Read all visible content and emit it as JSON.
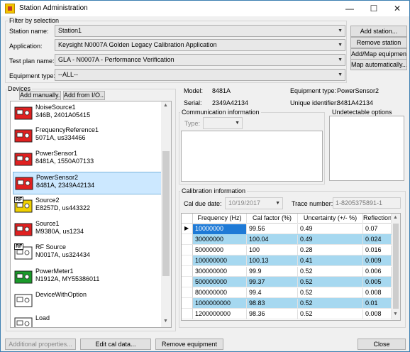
{
  "window": {
    "title": "Station Administration",
    "minimize": "—",
    "maximize": "☐",
    "close": "✕"
  },
  "filter": {
    "group_title": "Filter by selection",
    "station_label": "Station name:",
    "station_value": "Station1",
    "application_label": "Application:",
    "application_value": "Keysight N0007A Golden Legacy Calibration Application",
    "testplan_label": "Test plan name:",
    "testplan_value": "GLA - N0007A - Performance Verification",
    "equiptype_label": "Equipment type:",
    "equiptype_value": "--ALL--"
  },
  "side_buttons": {
    "add_station": "Add station...",
    "remove_station": "Remove station",
    "add_map": "Add/Map equipment...",
    "map_auto": "Map automatically..."
  },
  "devices": {
    "group_title": "Devices",
    "add_manually": "Add manually...",
    "add_from_io": "Add from I/O...",
    "items": [
      {
        "name": "NoiseSource1",
        "detail": "346B, 2401A05415",
        "icon": "noise-source-icon",
        "color": "#e02020"
      },
      {
        "name": "FrequencyReference1",
        "detail": "5071A, us334466",
        "icon": "frequency-reference-icon",
        "color": "#e02020"
      },
      {
        "name": "PowerSensor1",
        "detail": "8481A, 1550A07133",
        "icon": "power-sensor-icon",
        "color": "#e02020"
      },
      {
        "name": "PowerSensor2",
        "detail": "8481A, 2349A42134",
        "icon": "power-sensor-icon",
        "color": "#e02020"
      },
      {
        "name": "Source2",
        "detail": "E8257D, us443322",
        "icon": "rf-source-icon",
        "color": "#f0d000",
        "badge": "RF"
      },
      {
        "name": "Source1",
        "detail": "M9380A, us1234",
        "icon": "source-icon",
        "color": "#e02020"
      },
      {
        "name": "RF Source",
        "detail": "N0017A, us324434",
        "icon": "rf-source-icon",
        "color": "#ffffff",
        "badge": "RF"
      },
      {
        "name": "PowerMeter1",
        "detail": "N1912A, MY55386011",
        "icon": "power-meter-icon",
        "color": "#1a9a2a"
      },
      {
        "name": "DeviceWithOption",
        "detail": "",
        "icon": "generic-device-icon",
        "color": "#ffffff"
      },
      {
        "name": "Load",
        "detail": "",
        "icon": "generic-device-icon",
        "color": "#ffffff"
      }
    ]
  },
  "details": {
    "model_label": "Model:",
    "model_value": "8481A",
    "serial_label": "Serial:",
    "serial_value": "2349A42134",
    "equiptype_label": "Equipment type:",
    "equiptype_value": "PowerSensor2",
    "uid_label": "Unique identifier:",
    "uid_value": "8481A42134"
  },
  "comm": {
    "group_title": "Communication information",
    "type_label": "Type:"
  },
  "undetectable": {
    "group_title": "Undetectable options"
  },
  "calibration": {
    "group_title": "Calibration information",
    "due_label": "Cal due date:",
    "due_value": "10/19/2017",
    "trace_label": "Trace number:",
    "trace_value": "1-8205375891-1",
    "columns": [
      "Frequency (Hz)",
      "Cal factor (%)",
      "Uncertainty (+/- %)",
      "Reflection co"
    ],
    "rows": [
      [
        "10000000",
        "99.56",
        "0.49",
        "0.07"
      ],
      [
        "30000000",
        "100.04",
        "0.49",
        "0.024"
      ],
      [
        "50000000",
        "100",
        "0.28",
        "0.016"
      ],
      [
        "100000000",
        "100.13",
        "0.41",
        "0.009"
      ],
      [
        "300000000",
        "99.9",
        "0.52",
        "0.006"
      ],
      [
        "500000000",
        "99.37",
        "0.52",
        "0.005"
      ],
      [
        "800000000",
        "99.4",
        "0.52",
        "0.008"
      ],
      [
        "1000000000",
        "98.83",
        "0.52",
        "0.01"
      ],
      [
        "1200000000",
        "98.36",
        "0.52",
        "0.008"
      ]
    ]
  },
  "bottom": {
    "additional": "Additional properties...",
    "edit_cal": "Edit cal data...",
    "remove_equipment": "Remove equipment",
    "close": "Close"
  }
}
